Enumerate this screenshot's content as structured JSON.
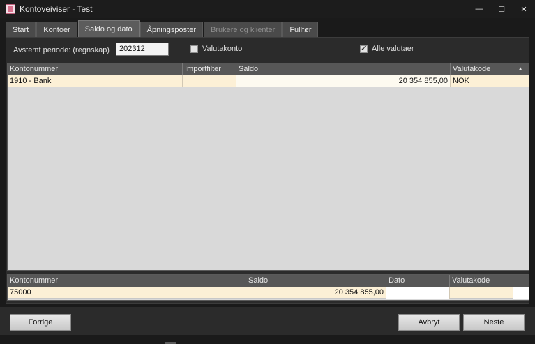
{
  "window": {
    "title": "Kontoveiviser - Test",
    "minimize": "—",
    "maximize": "☐",
    "close": "✕"
  },
  "tabs": [
    {
      "label": "Start",
      "state": "normal"
    },
    {
      "label": "Kontoer",
      "state": "normal"
    },
    {
      "label": "Saldo og dato",
      "state": "active"
    },
    {
      "label": "Åpningsposter",
      "state": "normal"
    },
    {
      "label": "Brukere og klienter",
      "state": "disabled"
    },
    {
      "label": "Fullfør",
      "state": "normal"
    }
  ],
  "form": {
    "period_label": "Avstemt periode: (regnskap)",
    "period_value": "202312",
    "valutakonto_label": "Valutakonto",
    "valutakonto_checked": false,
    "alle_valutaer_label": "Alle valutaer",
    "alle_valutaer_checked": true
  },
  "top_grid": {
    "headers": [
      "Kontonummer",
      "Importfilter",
      "Saldo",
      "Valutakode"
    ],
    "sort_indicator": "▲",
    "rows": [
      {
        "kontonummer": "1910 - Bank",
        "importfilter": "",
        "saldo": "20 354 855,00",
        "valutakode": "NOK"
      }
    ]
  },
  "bottom_grid": {
    "headers": [
      "Kontonummer",
      "Saldo",
      "Dato",
      "Valutakode",
      ""
    ],
    "rows": [
      {
        "kontonummer": "75000",
        "saldo": "20 354 855,00",
        "dato": "",
        "valutakode": "",
        "extra": ""
      }
    ]
  },
  "buttons": {
    "previous": "Forrige",
    "cancel": "Avbryt",
    "next": "Neste"
  },
  "colors": {
    "row_highlight": "#fcf0d6",
    "panel_bg": "#2b2b2b",
    "header_bg": "#575757"
  }
}
